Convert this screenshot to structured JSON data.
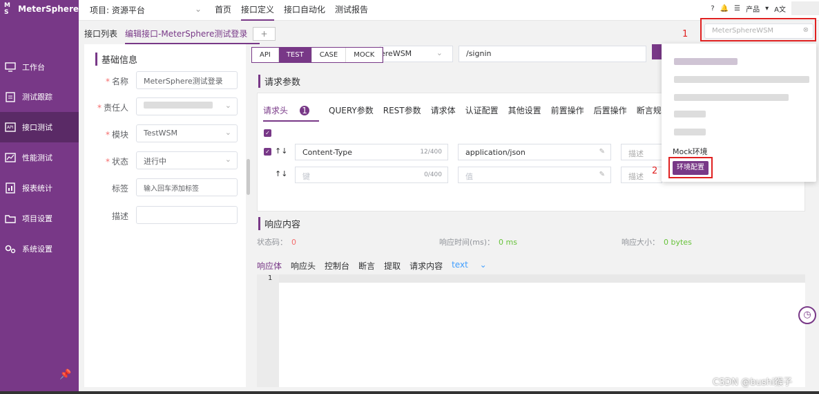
{
  "app": {
    "logo_text": "MeterSphere",
    "logo_mark": "M S",
    "project_label": "项目: 资源平台",
    "top_nav": [
      "首页",
      "接口定义",
      "接口自动化",
      "测试报告"
    ],
    "top_right": [
      "?",
      "🔔",
      "产品",
      "A文"
    ]
  },
  "sidebar": {
    "items": [
      {
        "label": "工作台",
        "icon": "monitor-icon"
      },
      {
        "label": "测试跟踪",
        "icon": "clipboard-icon"
      },
      {
        "label": "接口测试",
        "icon": "api-icon"
      },
      {
        "label": "性能测试",
        "icon": "chart-icon"
      },
      {
        "label": "报表统计",
        "icon": "report-icon"
      },
      {
        "label": "项目设置",
        "icon": "folder-icon"
      },
      {
        "label": "系统设置",
        "icon": "gear-icon"
      }
    ],
    "pin_icon": "📌"
  },
  "tabs": {
    "list_tab": "接口列表",
    "edit_tab": "编辑接口-MeterSphere测试登录",
    "close": "×",
    "add": "+"
  },
  "basic_info": {
    "title": "基础信息",
    "name_label": "名称",
    "name_value": "MeterSphere测试登录",
    "owner_label": "责任人",
    "module_label": "模块",
    "module_value": "TestWSM",
    "status_label": "状态",
    "status_value": "进行中",
    "tag_label": "标签",
    "tag_placeholder": "输入回车添加标签",
    "desc_label": "描述"
  },
  "mode_tabs": [
    "API",
    "TEST",
    "CASE",
    "MOCK"
  ],
  "request": {
    "env_value": "ereWSM",
    "path": "/signin",
    "section_title": "请求参数",
    "subtabs": [
      "请求头",
      "QUERY参数",
      "REST参数",
      "请求体",
      "认证配置",
      "其他设置",
      "前置操作",
      "后置操作",
      "断言规则"
    ],
    "header_badge": "1",
    "row1": {
      "key": "Content-Type",
      "key_count": "12/400",
      "value": "application/json",
      "desc": "描述"
    },
    "row2": {
      "key": "键",
      "key_count": "0/400",
      "value": "值",
      "desc": "描述"
    }
  },
  "response": {
    "title": "响应内容",
    "status_label": "状态码：",
    "status_value": "0",
    "time_label": "响应时间(ms)：",
    "time_value": "0 ms",
    "size_label": "响应大小：",
    "size_value": "0 bytes",
    "tabs": [
      "响应体",
      "响应头",
      "控制台",
      "断言",
      "提取",
      "请求内容",
      "text"
    ],
    "line_no": "1"
  },
  "env_dropdown": {
    "search_value": "MeterSphereWSM",
    "mock_label": "Mock环境",
    "config_button": "环境配置",
    "marker1": "1",
    "marker2": "2"
  },
  "watermark": "CSDN @bushi猴子",
  "colors": {
    "brand": "#783887",
    "danger": "#f56c6c",
    "success": "#67c23a",
    "link": "#409eff"
  }
}
